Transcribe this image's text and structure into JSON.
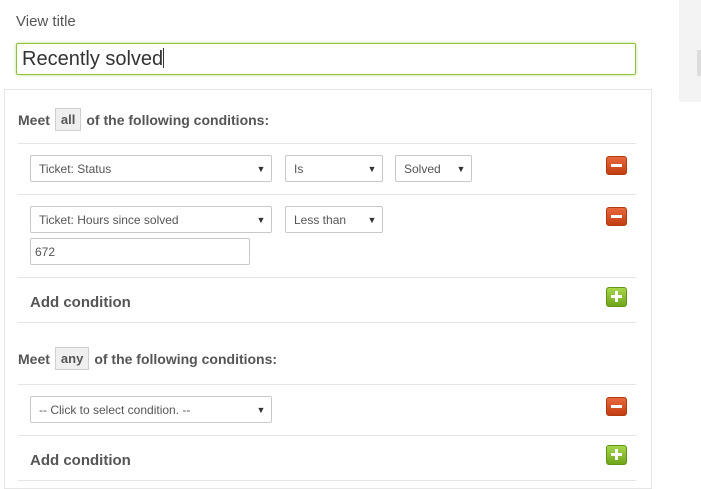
{
  "view_title": {
    "label": "View title",
    "value": "Recently solved"
  },
  "all_group": {
    "prefix": "Meet",
    "mode": "all",
    "suffix": "of the following conditions:",
    "conditions": [
      {
        "field": "Ticket: Status",
        "operator": "Is",
        "value": "Solved"
      },
      {
        "field": "Ticket: Hours since solved",
        "operator": "Less than",
        "value": "672"
      }
    ],
    "add_label": "Add condition"
  },
  "any_group": {
    "prefix": "Meet",
    "mode": "any",
    "suffix": "of the following conditions:",
    "conditions": [
      {
        "field": "-- Click to select condition. --"
      }
    ],
    "add_label": "Add condition"
  },
  "icons": {
    "dropdown": "caret-down-icon",
    "remove": "minus-icon",
    "add": "plus-icon"
  },
  "colors": {
    "focus_border": "#8fc33a",
    "remove_button": "#d5501f",
    "add_button": "#8cc63f"
  }
}
